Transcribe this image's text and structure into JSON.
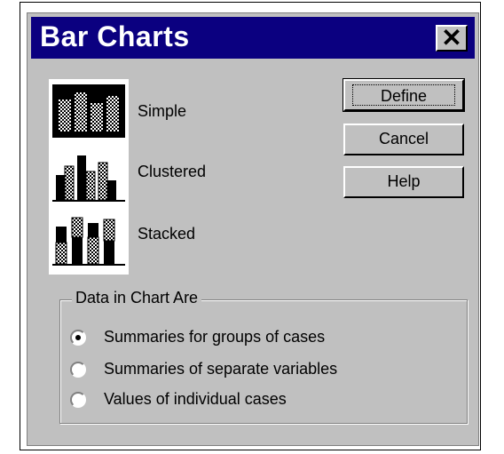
{
  "window": {
    "title": "Bar Charts",
    "close_symbol": "✕"
  },
  "chart_types": [
    {
      "label": "Simple",
      "icon": "simple-bar-chart-icon",
      "selected": true
    },
    {
      "label": "Clustered",
      "icon": "clustered-bar-chart-icon",
      "selected": false
    },
    {
      "label": "Stacked",
      "icon": "stacked-bar-chart-icon",
      "selected": false
    }
  ],
  "buttons": {
    "define": "Define",
    "cancel": "Cancel",
    "help": "Help"
  },
  "data_group": {
    "legend": "Data in Chart Are",
    "options": [
      {
        "label": "Summaries for groups of cases",
        "selected": true
      },
      {
        "label": "Summaries of separate variables",
        "selected": false
      },
      {
        "label": "Values of individual cases",
        "selected": false
      }
    ]
  },
  "colors": {
    "titlebar": "#0b0080",
    "dialog_face": "#c0c0c0"
  }
}
